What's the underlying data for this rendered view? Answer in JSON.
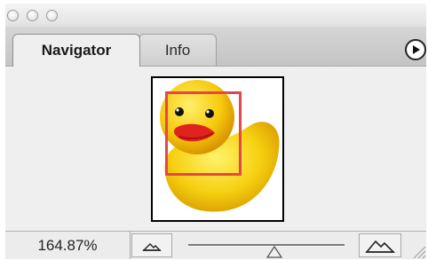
{
  "window": {
    "tabs": [
      {
        "label": "Navigator",
        "active": true
      },
      {
        "label": "Info",
        "active": false
      }
    ]
  },
  "navigator": {
    "zoom_value": "164.87%",
    "zoom_slider_fraction": 0.55,
    "view_box_color": "#e4464e",
    "thumbnail_icon": "rubber-duck-image"
  },
  "icons": {
    "palette_menu": "right-arrow-circle-icon",
    "zoom_out": "small-mountain-icon",
    "zoom_in": "large-mountain-icon"
  }
}
